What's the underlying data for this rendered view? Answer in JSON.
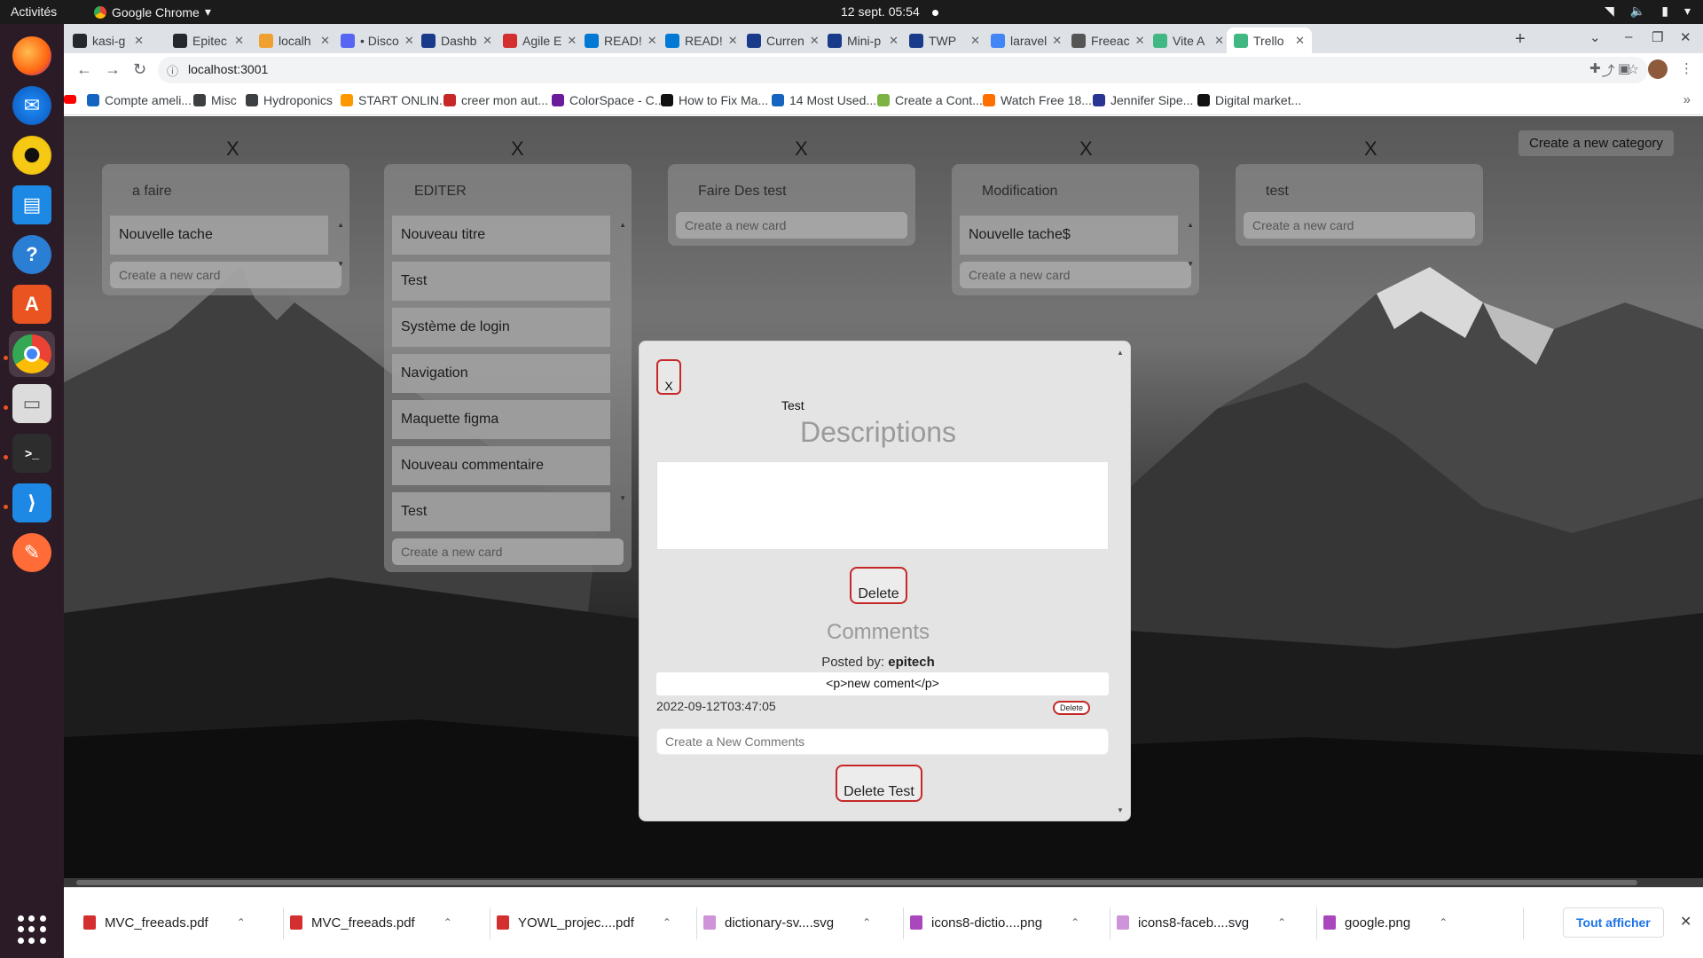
{
  "os_bar": {
    "activities": "Activités",
    "app_name": "Google Chrome",
    "clock": "12 sept.  05:54"
  },
  "dock": {
    "apps": [
      "firefox-icon",
      "thunderbird-icon",
      "rhythmbox-icon",
      "writer-icon",
      "help-icon",
      "software-icon",
      "chrome-icon",
      "files-icon",
      "terminal-icon",
      "vscode-icon",
      "postman-icon"
    ]
  },
  "tabs": [
    {
      "label": "kasi-g",
      "color": "#24292f"
    },
    {
      "label": "Epitec",
      "color": "#24292f"
    },
    {
      "label": "localh",
      "color": "#f0a030"
    },
    {
      "label": "• Disco",
      "color": "#5865f2"
    },
    {
      "label": "Dashb",
      "color": "#1a3a8a"
    },
    {
      "label": "Agile E",
      "color": "#d32f2f"
    },
    {
      "label": "READ!",
      "color": "#0078d4"
    },
    {
      "label": "READ!",
      "color": "#0078d4"
    },
    {
      "label": "Curren",
      "color": "#1a3a8a"
    },
    {
      "label": "Mini-p",
      "color": "#1a3a8a"
    },
    {
      "label": "TWP",
      "color": "#1a3a8a"
    },
    {
      "label": "laravel",
      "color": "#4285f4"
    },
    {
      "label": "Freeac",
      "color": "#555555"
    },
    {
      "label": "Vite A",
      "color": "#41b883"
    },
    {
      "label": "Trello",
      "color": "#41b883"
    }
  ],
  "address_bar": {
    "url": "localhost:3001"
  },
  "bookmarks": [
    {
      "label": "Compte ameli...",
      "color": "#1565c0"
    },
    {
      "label": "Misc",
      "color": "#3c4043"
    },
    {
      "label": "Hydroponics",
      "color": "#3c4043"
    },
    {
      "label": "START ONLIN...",
      "color": "#ff9800"
    },
    {
      "label": "creer mon aut...",
      "color": "#c62828"
    },
    {
      "label": "ColorSpace - C...",
      "color": "#6a1b9a"
    },
    {
      "label": "How to Fix Ma...",
      "color": "#111111"
    },
    {
      "label": "14 Most Used...",
      "color": "#1565c0"
    },
    {
      "label": "Create a Cont...",
      "color": "#7cb342"
    },
    {
      "label": "Watch Free 18...",
      "color": "#ff6f00"
    },
    {
      "label": "Jennifer Sipe...",
      "color": "#283593"
    },
    {
      "label": "Digital market...",
      "color": "#111111"
    }
  ],
  "board": {
    "close_label": "X",
    "new_category": "Create a new category",
    "new_card_placeholder": "Create a new card",
    "columns": [
      {
        "title": "a faire",
        "cards": [
          "Nouvelle tache"
        ]
      },
      {
        "title": "EDITER",
        "cards": [
          "Nouveau titre",
          "Test",
          "Système de login",
          "Navigation",
          "Maquette figma",
          "Nouveau commentaire",
          "Test"
        ]
      },
      {
        "title": "Faire Des test",
        "cards": []
      },
      {
        "title": "Modification",
        "cards": [
          "Nouvelle tache$"
        ]
      },
      {
        "title": "test",
        "cards": []
      }
    ]
  },
  "modal": {
    "close_label": "X",
    "card_title": "Test",
    "descriptions_heading": "Descriptions",
    "delete_label": "Delete",
    "comments_heading": "Comments",
    "posted_by_label": "Posted by:",
    "posted_by_user": "epitech",
    "comment_body": "<p>new coment</p>",
    "comment_date": "2022-09-12T03:47:05",
    "comment_delete": "Delete",
    "new_comment_placeholder": "Create a New Comments",
    "delete_card_label": "Delete Test"
  },
  "downloads": {
    "items": [
      {
        "name": "MVC_freeads.pdf",
        "color": "#d32f2f"
      },
      {
        "name": "MVC_freeads.pdf",
        "color": "#d32f2f"
      },
      {
        "name": "YOWL_projec....pdf",
        "color": "#d32f2f"
      },
      {
        "name": "dictionary-sv....svg",
        "color": "#ce93d8"
      },
      {
        "name": "icons8-dictio....png",
        "color": "#ab47bc"
      },
      {
        "name": "icons8-faceb....svg",
        "color": "#ce93d8"
      },
      {
        "name": "google.png",
        "color": "#ab47bc"
      }
    ],
    "show_all": "Tout afficher"
  }
}
